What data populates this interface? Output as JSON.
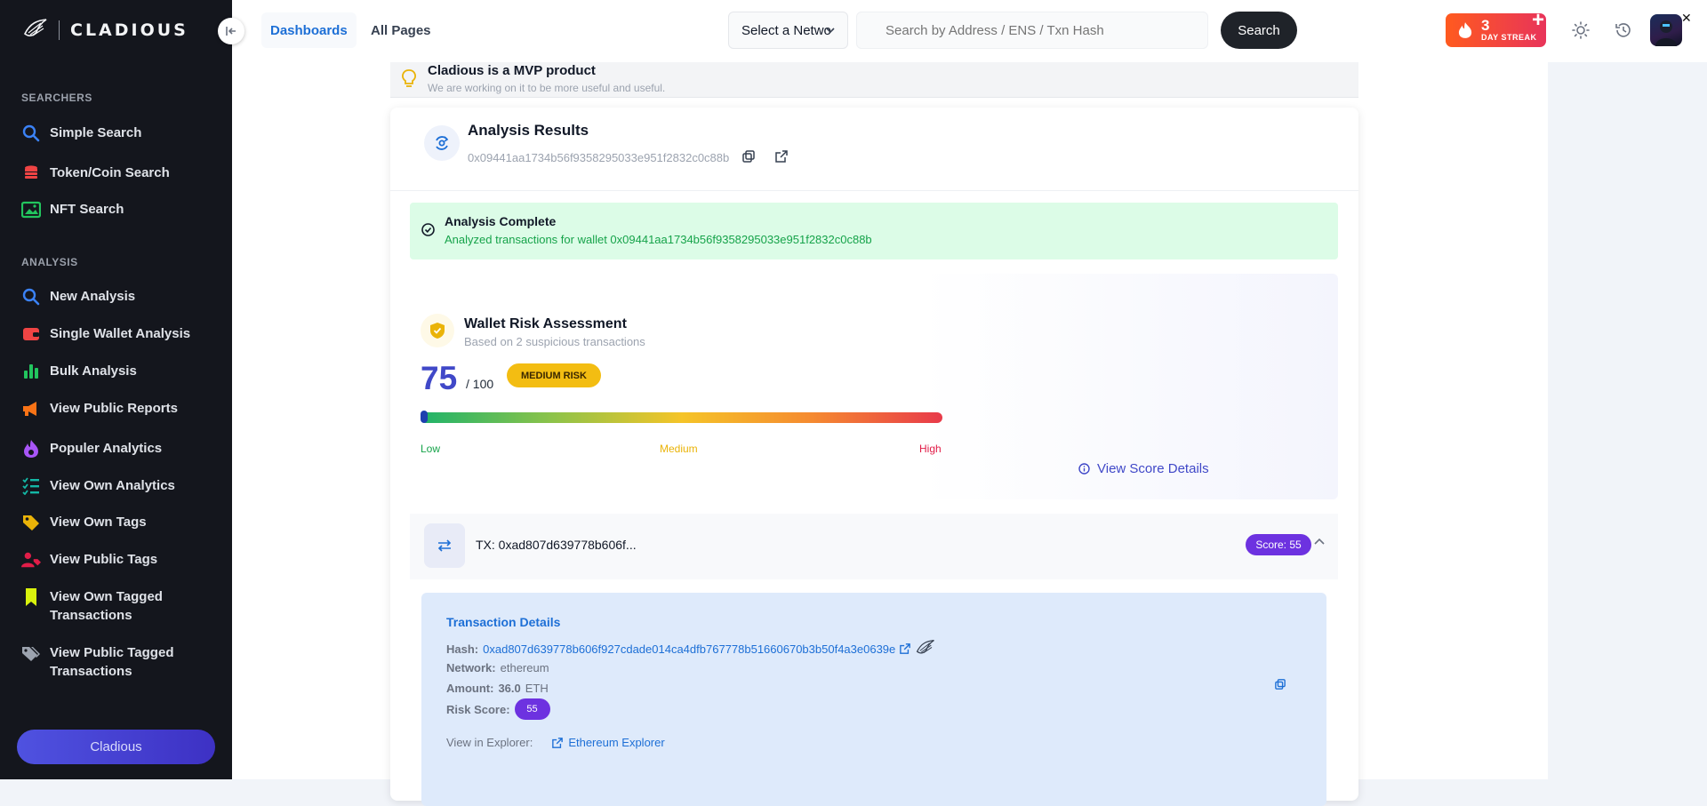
{
  "brand": {
    "name": "CLADIOUS"
  },
  "sidebar": {
    "sections": [
      {
        "title": "SEARCHERS",
        "items": [
          {
            "label": "Simple Search",
            "icon": "search-icon",
            "color": "#3b82f6"
          },
          {
            "label": "Token/Coin Search",
            "icon": "coins-icon",
            "color": "#ef4444"
          },
          {
            "label": "NFT Search",
            "icon": "image-icon",
            "color": "#22c55e"
          }
        ]
      },
      {
        "title": "ANALYSIS",
        "items": [
          {
            "label": "New Analysis",
            "icon": "search-icon",
            "color": "#3b82f6"
          },
          {
            "label": "Single Wallet Analysis",
            "icon": "wallet-icon",
            "color": "#ef4444"
          },
          {
            "label": "Bulk Analysis",
            "icon": "bar-chart-icon",
            "color": "#22c55e"
          },
          {
            "label": "View Public Reports",
            "icon": "megaphone-icon",
            "color": "#f97316"
          },
          {
            "label": "Populer Analytics",
            "icon": "flame-icon",
            "color": "#a855f7"
          },
          {
            "label": "View Own Analytics",
            "icon": "list-check-icon",
            "color": "#14b8a6"
          },
          {
            "label": "View Own Tags",
            "icon": "tag-icon",
            "color": "#eab308"
          },
          {
            "label": "View Public Tags",
            "icon": "user-tag-icon",
            "color": "#e11d48"
          },
          {
            "label": "View Own Tagged Transactions",
            "icon": "bookmark-icon",
            "color": "#d9f20d"
          },
          {
            "label": "View Public Tagged Transactions",
            "icon": "tags-icon",
            "color": "#9ca3af"
          }
        ]
      }
    ],
    "bottom_button": "Cladious"
  },
  "topbar": {
    "nav": [
      {
        "label": "Dashboards",
        "active": true
      },
      {
        "label": "All Pages",
        "active": false
      }
    ],
    "network_select": "Select a Network",
    "search_placeholder": "Search by Address / ENS / Txn Hash",
    "search_button": "Search",
    "streak": {
      "count": "3",
      "label": "DAY STREAK"
    }
  },
  "banner": {
    "title": "Cladious is a MVP product",
    "subtitle": "We are working on it to be more useful and useful."
  },
  "analysis": {
    "title": "Analysis Results",
    "address": "0x09441aa1734b56f9358295033e951f2832c0c88b",
    "complete_title": "Analysis Complete",
    "complete_message": "Analyzed transactions for wallet 0x09441aa1734b56f9358295033e951f2832c0c88b"
  },
  "risk": {
    "title": "Wallet Risk Assessment",
    "subtitle": "Based on 2 suspicious transactions",
    "score": "75",
    "max": "/ 100",
    "level": "MEDIUM RISK",
    "marker_fraction": 0.0,
    "scale_low": "Low",
    "scale_medium": "Medium",
    "scale_high": "High",
    "details_link": "View Score Details"
  },
  "transaction": {
    "label": "TX: 0xad807d639778b606f...",
    "score_badge": "Score: 55",
    "details": {
      "title": "Transaction Details",
      "hash_key": "Hash:",
      "hash": "0xad807d639778b606f927cdade014ca4dfb767778b51660670b3b50f4a3e0639e",
      "network_key": "Network:",
      "network": "ethereum",
      "amount_key": "Amount:",
      "amount_value": "36.0",
      "amount_unit": "ETH",
      "risk_key": "Risk Score:",
      "risk_value": "55",
      "explorer_key": "View in Explorer:",
      "explorer_link": "Ethereum Explorer"
    }
  }
}
